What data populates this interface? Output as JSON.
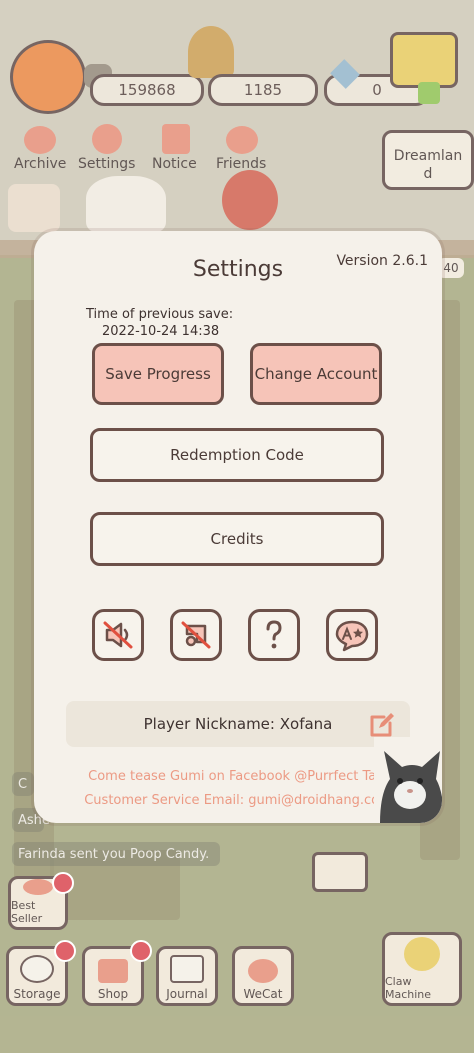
{
  "hud": {
    "fish_count": "159868",
    "coin_count": "1185",
    "gem_count": "0"
  },
  "top_menu": {
    "archive": "Archive",
    "settings": "Settings",
    "notice": "Notice",
    "friends": "Friends",
    "dreamland_line1": "Dreamlan",
    "dreamland_line2": "d",
    "level_badge": "40"
  },
  "chat": {
    "line1": "C",
    "line2": "Ashe",
    "line3": "Farinda sent you Poop Candy."
  },
  "bottom_bar": {
    "best_seller": "Best Seller",
    "storage": "Storage",
    "shop": "Shop",
    "journal": "Journal",
    "wecat": "WeCat",
    "claw_machine": "Claw Machine"
  },
  "settings": {
    "title": "Settings",
    "version": "Version 2.6.1",
    "save_time_label": "Time of previous save:",
    "save_time_value": "2022-10-24 14:38",
    "save_progress": "Save Progress",
    "change_account": "Change Account",
    "redemption_code": "Redemption Code",
    "credits": "Credits",
    "icons": [
      "sound-off-icon",
      "music-off-icon",
      "help-icon",
      "language-icon"
    ],
    "nickname": "Player Nickname: Xofana",
    "facebook_text": "Come tease Gumi on Facebook @Purrfect Tale",
    "support_text": "Customer Service Email: gumi@droidhang.com"
  },
  "colors": {
    "accent_pink": "#f6c4b8",
    "border_brown": "#6c5049",
    "promo_text": "#ec9a84",
    "panel_bg": "#f5f1ea"
  }
}
